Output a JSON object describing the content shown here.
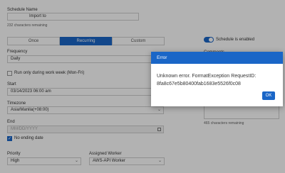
{
  "form": {
    "schedule_name_label": "Schedule Name",
    "schedule_name_value": "Import to",
    "chars_remaining": "232 characters remaining",
    "tabs": [
      {
        "label": "Once"
      },
      {
        "label": "Recurring",
        "active": true
      },
      {
        "label": "Custom"
      }
    ],
    "frequency_label": "Frequency",
    "frequency_value": "Daily",
    "workweek_label": "Run only during work week (Mon-Fri)",
    "start_label": "Start",
    "start_value": "03/14/2023 06:00 am",
    "timezone_label": "Timezone",
    "timezone_value": "Asia/Manila(+08:00)",
    "end_label": "End",
    "end_placeholder": "MM/DD/YYYY",
    "no_ending_date_label": "No ending date",
    "priority_label": "Priority",
    "priority_value": "High",
    "assigned_worker_label": "Assigned Worker",
    "assigned_worker_value": "AWS-API Worker"
  },
  "right": {
    "schedule_enabled_label": "Schedule is enabled",
    "comments_label": "Comments",
    "comments_remaining": "465 characters remaining"
  },
  "dialog": {
    "title": "Error",
    "message_line1": "Unknown error. FormatException RequestID:",
    "message_line2": "8fa8c67e5b80400fab1683e5526f0c08",
    "ok_label": "OK"
  },
  "colors": {
    "accent": "#1a66c7",
    "overlay": "rgba(0,0,0,0.30)"
  },
  "icons": [
    "chevron-down-icon",
    "calendar-icon",
    "checkbox-checked-icon",
    "toggle-on-icon"
  ]
}
